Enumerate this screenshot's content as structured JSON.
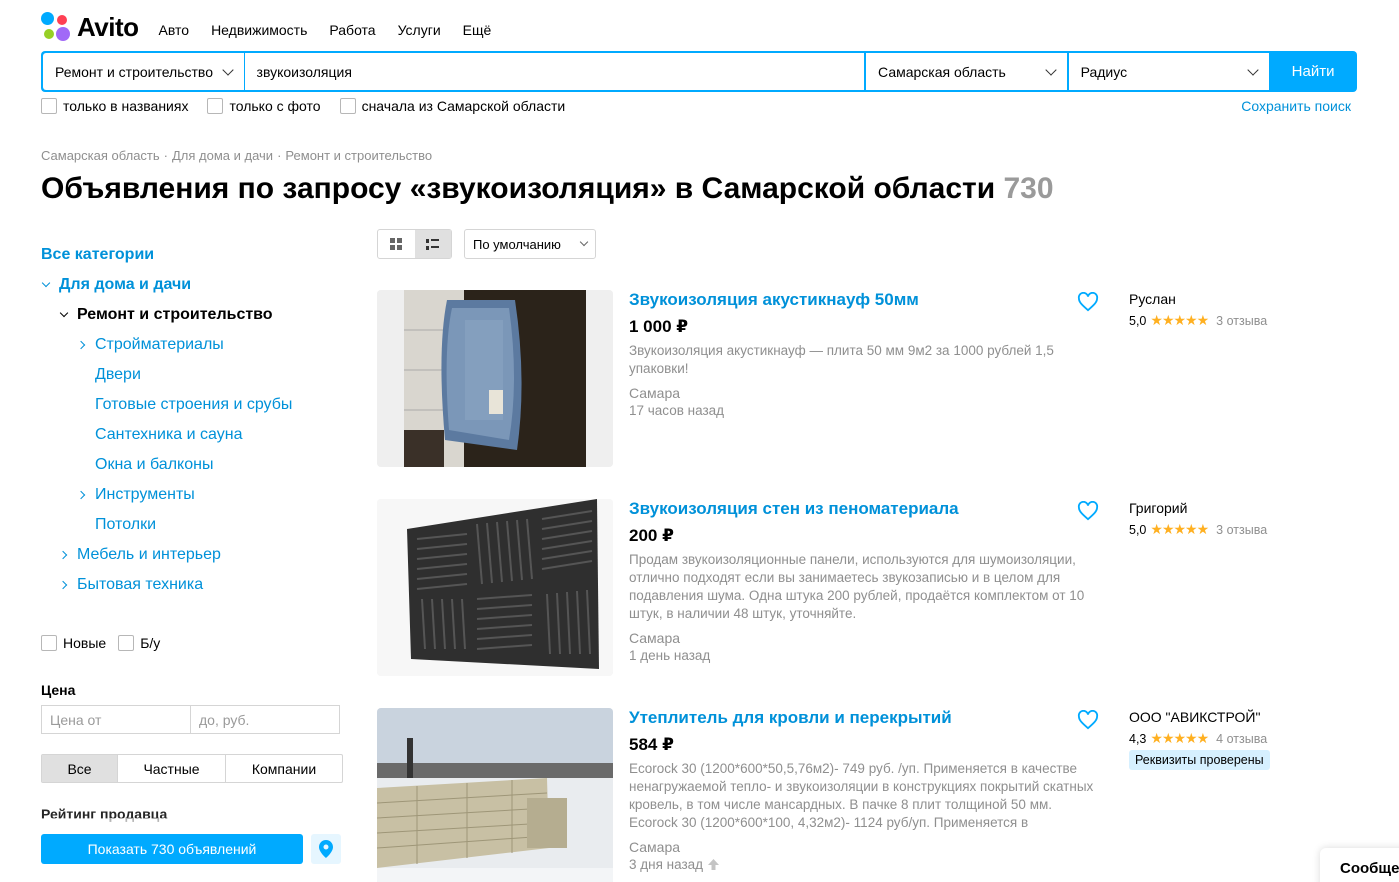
{
  "header": {
    "logo": "Avito",
    "nav": [
      "Авто",
      "Недвижимость",
      "Работа",
      "Услуги",
      "Ещё"
    ]
  },
  "search": {
    "category": "Ремонт и строительство",
    "query": "звукоизоляция",
    "region": "Самарская область",
    "radius": "Радиус",
    "submit": "Найти"
  },
  "filters": {
    "only_titles": "только в названиях",
    "only_photo": "только с фото",
    "region_first": "сначала из Самарской области",
    "save_search": "Сохранить поиск"
  },
  "breadcrumb": [
    "Самарская область",
    "Для дома и дачи",
    "Ремонт и строительство"
  ],
  "breadcrumb_sep": "·",
  "title": {
    "text": "Объявления по запросу «звукоизоляция» в Самарской области",
    "count": "730"
  },
  "sidebar": {
    "all": "Все категории",
    "home": "Для дома и дачи",
    "repair": "Ремонт и строительство",
    "sub": [
      "Стройматериалы",
      "Двери",
      "Готовые строения и срубы",
      "Сантехника и сауна",
      "Окна и балконы",
      "Инструменты",
      "Потолки"
    ],
    "furniture": "Мебель и интерьер",
    "appliances": "Бытовая техника",
    "cond_new": "Новые",
    "cond_used": "Б/у",
    "price_label": "Цена",
    "price_from": "Цена от",
    "price_to": "до, руб.",
    "seller_types": [
      "Все",
      "Частные",
      "Компании"
    ],
    "rating_label": "Рейтинг продавца",
    "show_button": "Показать 730 объявлений"
  },
  "toolbar": {
    "sort": "По умолчанию"
  },
  "listings": [
    {
      "title": "Звукоизоляция акустикнауф 50мм",
      "price": "1 000 ₽",
      "desc": "Звукоизоляция акустикнауф — плита 50 мм 9м2 за 1000 рублей 1,5 упаковки!",
      "city": "Самара",
      "time": "17 часов назад",
      "seller": "Руслан",
      "rating": "5,0",
      "stars": "★★★★★",
      "reviews": "3 отзыва"
    },
    {
      "title": "Звукоизоляция стен из пеноматериала",
      "price": "200 ₽",
      "desc": "Продам звукоизоляционные панели, используются для шумоизоляции, отлично подходят если вы занимаетесь звукозаписью и в целом для подавления шума. Одна штука 200 рублей, продаётся комплектом от 10 штук, в наличии 48 штук, уточняйте.",
      "city": "Самара",
      "time": "1 день назад",
      "seller": "Григорий",
      "rating": "5,0",
      "stars": "★★★★★",
      "reviews": "3 отзыва"
    },
    {
      "title": "Утеплитель для кровли и перекрытий",
      "price": "584 ₽",
      "desc": "Ecorock 30 (1200*600*50,5,76м2)- 749 руб. /уп. Применяется в качестве ненагружаемой тепло- и звукоизоляции в конструкциях покрытий скатных кровель, в том числе мансардных. В пачке 8 плит толщиной 50 мм. Ecorock 30 (1200*600*100, 4,32м2)- 1124 руб/уп. Применяется в",
      "city": "Самара",
      "time": "3 дня назад",
      "seller": "ООО \"АВИКСТРОЙ\"",
      "rating": "4,3",
      "stars": "★★★★★",
      "reviews": "4 отзыва",
      "verified": "Реквизиты проверены"
    }
  ],
  "chat": "Сообщения",
  "colors": {
    "accent": "#00aaff",
    "link": "#0091d9",
    "star": "#ffb021"
  }
}
